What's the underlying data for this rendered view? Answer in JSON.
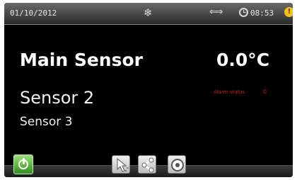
{
  "status": {
    "date": "01/10/2012",
    "time": "08:53",
    "icons": [
      "snowflake-icon",
      "arrows-icon",
      "clock-icon",
      "warning-icon"
    ]
  },
  "display": {
    "main_label": "Main Sensor",
    "main_value": "0.0°C",
    "sensor2_label": "Sensor 2",
    "sensor3_label": "Sensor 3",
    "alarm_label": "Alarm status",
    "alarm_value": "0"
  },
  "toolbar": {
    "buttons": [
      "power-button",
      "pointer-button",
      "share-button",
      "settings-button"
    ]
  },
  "colors": {
    "alarm": "#d21a1a",
    "power_button": "#3da42a",
    "warning": "#f0c21a"
  }
}
